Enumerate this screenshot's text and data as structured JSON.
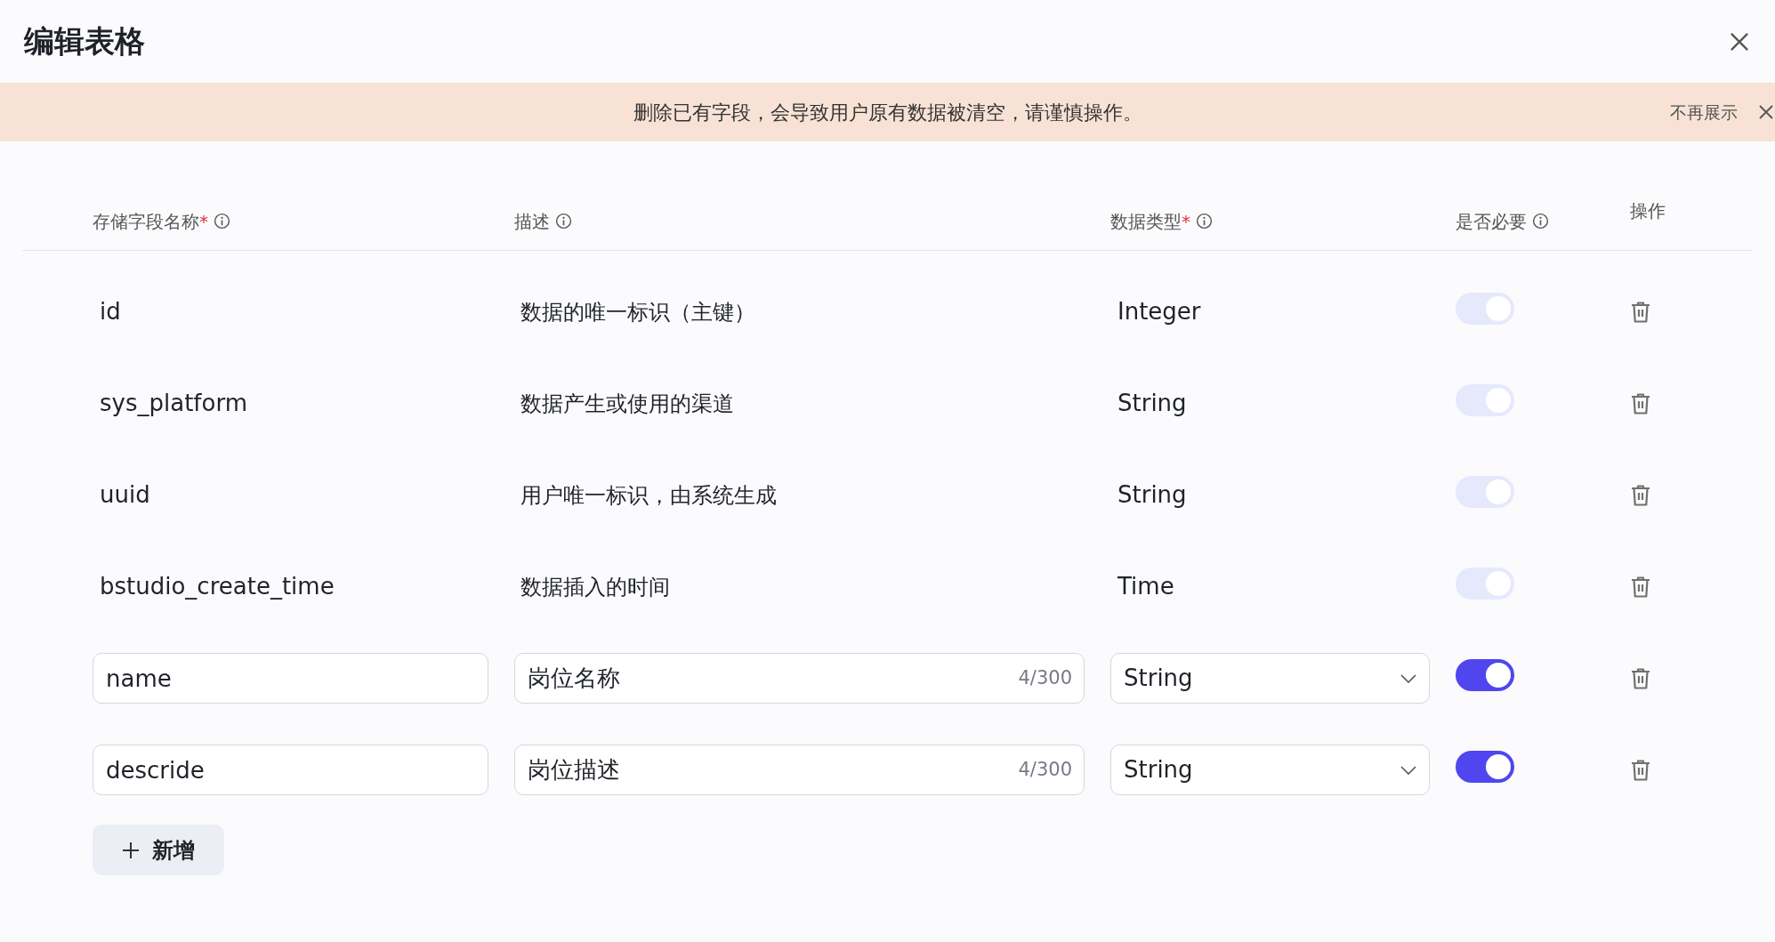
{
  "dialog": {
    "title": "编辑表格"
  },
  "banner": {
    "message": "删除已有字段，会导致用户原有数据被清空，请谨慎操作。",
    "dismiss_label": "不再展示"
  },
  "columns": [
    {
      "label": "存储字段名称",
      "required_mark": "*",
      "info": true
    },
    {
      "label": "描述",
      "info": true
    },
    {
      "label": "数据类型",
      "required_mark": "*",
      "info": true
    },
    {
      "label": "是否必要",
      "info": true
    },
    {
      "label": "操作",
      "info": false
    }
  ],
  "rows": [
    {
      "kind": "fixed",
      "name": "id",
      "description": "数据的唯一标识（主键）",
      "type": "Integer",
      "required_on": true,
      "disabled": true
    },
    {
      "kind": "fixed",
      "name": "sys_platform",
      "description": "数据产生或使用的渠道",
      "type": "String",
      "required_on": true,
      "disabled": true
    },
    {
      "kind": "fixed",
      "name": "uuid",
      "description": "用户唯一标识，由系统生成",
      "type": "String",
      "required_on": true,
      "disabled": true
    },
    {
      "kind": "fixed",
      "name": "bstudio_create_time",
      "description": "数据插入的时间",
      "type": "Time",
      "required_on": true,
      "disabled": true
    },
    {
      "kind": "editable",
      "name": "name",
      "description": "岗位名称",
      "counter": "4/300",
      "type": "String",
      "required_on": true,
      "disabled": false
    },
    {
      "kind": "editable",
      "name": "descride",
      "description": "岗位描述",
      "counter": "4/300",
      "type": "String",
      "required_on": true,
      "disabled": false
    }
  ],
  "add_button": {
    "label": "新增"
  }
}
